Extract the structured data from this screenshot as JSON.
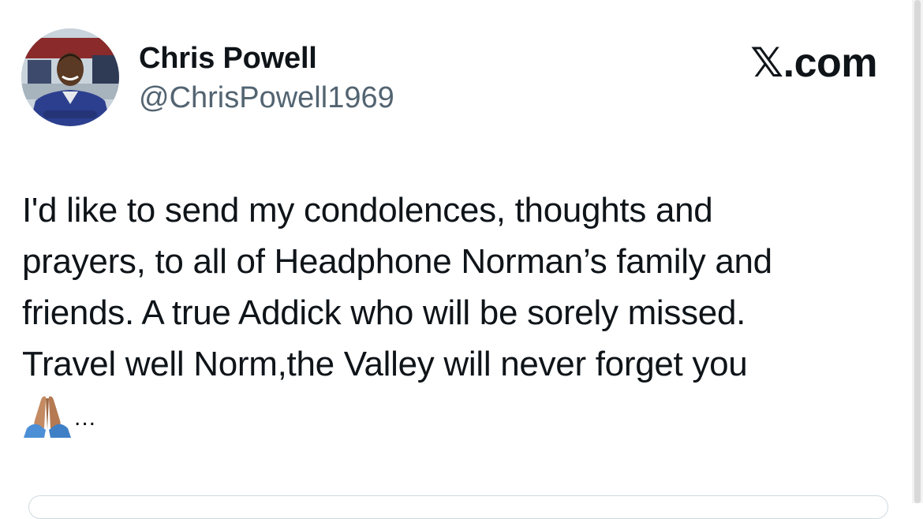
{
  "tweet": {
    "author": {
      "name": "Chris Powell",
      "handle": "@ChrisPowell1969",
      "avatar": "profile-photo"
    },
    "brand": "𝕏.com",
    "text_lines": [
      "I'd like to send my condolences, thoughts and",
      "prayers, to all of Headphone Norman’s family and",
      "friends. A true Addick who will be sorely missed.",
      "Travel well Norm,the Valley will never forget you"
    ],
    "emoji": "praying-hands-icon",
    "truncation": "..."
  },
  "colors": {
    "text": "#0f1419",
    "secondary": "#536471",
    "background": "#ffffff"
  }
}
